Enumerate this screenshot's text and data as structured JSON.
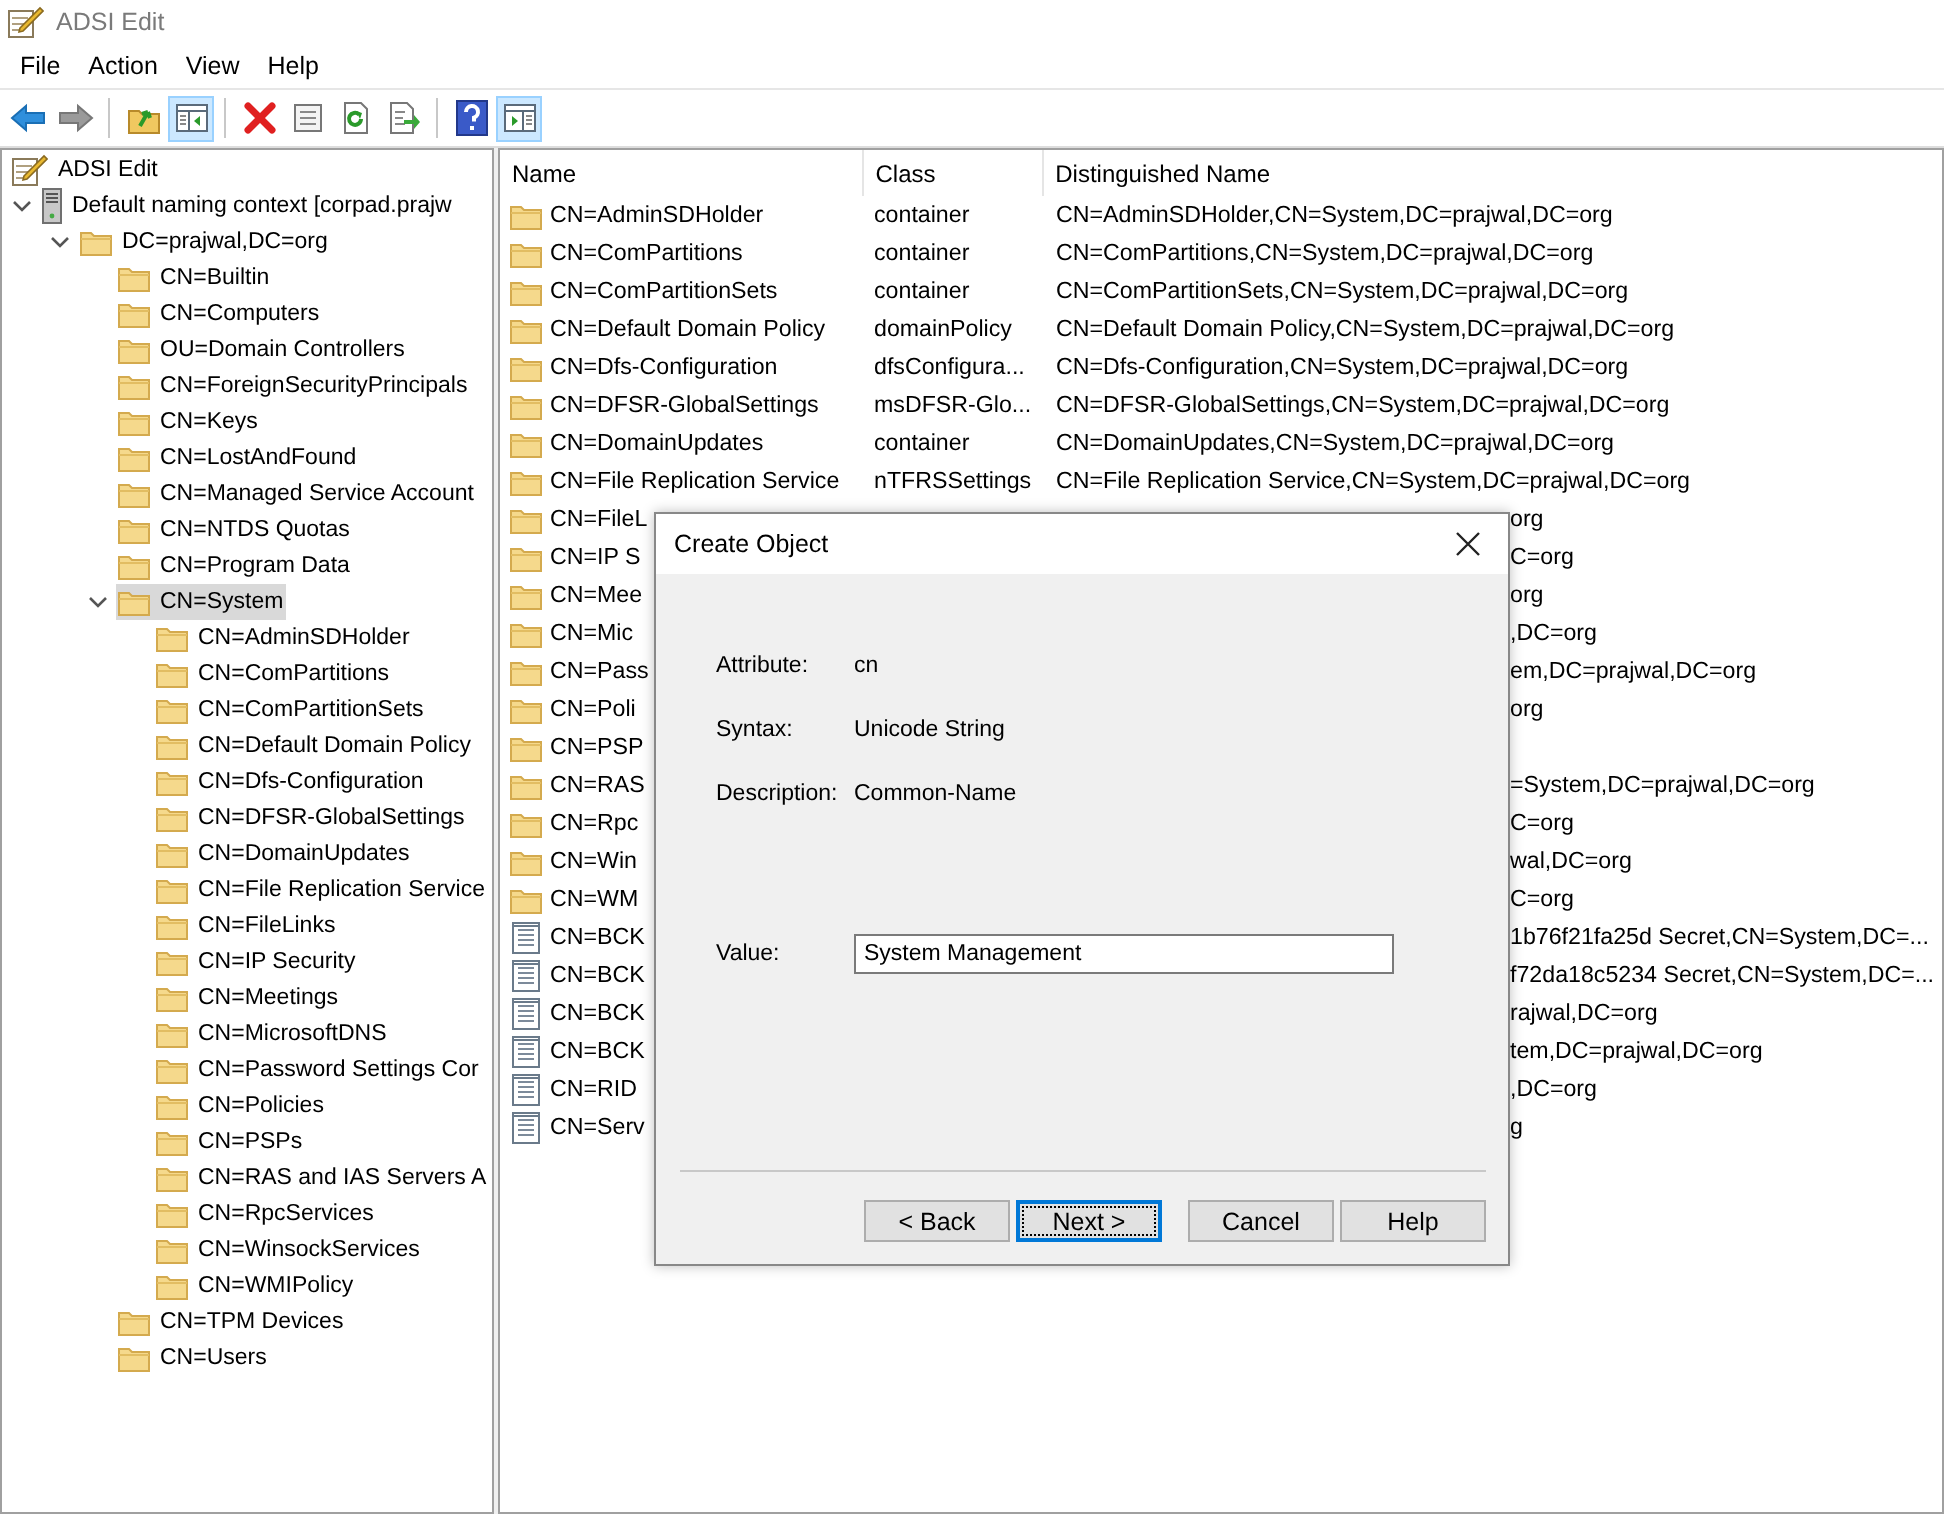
{
  "window": {
    "title": "ADSI Edit"
  },
  "menu": [
    "File",
    "Action",
    "View",
    "Help"
  ],
  "toolbar": [
    {
      "kind": "back",
      "pressed": false
    },
    {
      "kind": "forward",
      "pressed": false
    },
    {
      "kind": "sep"
    },
    {
      "kind": "up",
      "pressed": false
    },
    {
      "kind": "tree",
      "pressed": true
    },
    {
      "kind": "sep"
    },
    {
      "kind": "delete",
      "pressed": false
    },
    {
      "kind": "properties",
      "pressed": false
    },
    {
      "kind": "refresh",
      "pressed": false
    },
    {
      "kind": "export",
      "pressed": false
    },
    {
      "kind": "sep"
    },
    {
      "kind": "help",
      "pressed": false
    },
    {
      "kind": "action",
      "pressed": true
    }
  ],
  "tree": [
    {
      "label": "ADSI Edit",
      "kind": "snapin",
      "selected": false,
      "children": [
        {
          "label": "Default naming context [corpad.prajw",
          "kind": "server",
          "expanded": true,
          "selected": false,
          "children": [
            {
              "label": "DC=prajwal,DC=org",
              "kind": "folder",
              "expanded": true,
              "selected": false,
              "children": [
                {
                  "label": "CN=Builtin",
                  "kind": "folder",
                  "selected": false
                },
                {
                  "label": "CN=Computers",
                  "kind": "folder",
                  "selected": false
                },
                {
                  "label": "OU=Domain Controllers",
                  "kind": "folder",
                  "selected": false
                },
                {
                  "label": "CN=ForeignSecurityPrincipals",
                  "kind": "folder",
                  "selected": false
                },
                {
                  "label": "CN=Keys",
                  "kind": "folder",
                  "selected": false
                },
                {
                  "label": "CN=LostAndFound",
                  "kind": "folder",
                  "selected": false
                },
                {
                  "label": "CN=Managed Service Account",
                  "kind": "folder",
                  "selected": false
                },
                {
                  "label": "CN=NTDS Quotas",
                  "kind": "folder",
                  "selected": false
                },
                {
                  "label": "CN=Program Data",
                  "kind": "folder",
                  "selected": false
                },
                {
                  "label": "CN=System",
                  "kind": "folder",
                  "expanded": true,
                  "selected": true,
                  "children": [
                    {
                      "label": "CN=AdminSDHolder",
                      "kind": "folder",
                      "selected": false
                    },
                    {
                      "label": "CN=ComPartitions",
                      "kind": "folder",
                      "selected": false
                    },
                    {
                      "label": "CN=ComPartitionSets",
                      "kind": "folder",
                      "selected": false
                    },
                    {
                      "label": "CN=Default Domain Policy",
                      "kind": "folder",
                      "selected": false
                    },
                    {
                      "label": "CN=Dfs-Configuration",
                      "kind": "folder",
                      "selected": false
                    },
                    {
                      "label": "CN=DFSR-GlobalSettings",
                      "kind": "folder",
                      "selected": false
                    },
                    {
                      "label": "CN=DomainUpdates",
                      "kind": "folder",
                      "selected": false
                    },
                    {
                      "label": "CN=File Replication Service",
                      "kind": "folder",
                      "selected": false
                    },
                    {
                      "label": "CN=FileLinks",
                      "kind": "folder",
                      "selected": false
                    },
                    {
                      "label": "CN=IP Security",
                      "kind": "folder",
                      "selected": false
                    },
                    {
                      "label": "CN=Meetings",
                      "kind": "folder",
                      "selected": false
                    },
                    {
                      "label": "CN=MicrosoftDNS",
                      "kind": "folder",
                      "selected": false
                    },
                    {
                      "label": "CN=Password Settings Cor",
                      "kind": "folder",
                      "selected": false
                    },
                    {
                      "label": "CN=Policies",
                      "kind": "folder",
                      "selected": false
                    },
                    {
                      "label": "CN=PSPs",
                      "kind": "folder",
                      "selected": false
                    },
                    {
                      "label": "CN=RAS and IAS Servers A",
                      "kind": "folder",
                      "selected": false
                    },
                    {
                      "label": "CN=RpcServices",
                      "kind": "folder",
                      "selected": false
                    },
                    {
                      "label": "CN=WinsockServices",
                      "kind": "folder",
                      "selected": false
                    },
                    {
                      "label": "CN=WMIPolicy",
                      "kind": "folder",
                      "selected": false
                    }
                  ]
                },
                {
                  "label": "CN=TPM Devices",
                  "kind": "folder",
                  "selected": false
                },
                {
                  "label": "CN=Users",
                  "kind": "folder",
                  "selected": false
                }
              ]
            }
          ]
        }
      ]
    }
  ],
  "list": {
    "columns": [
      "Name",
      "Class",
      "Distinguished Name"
    ],
    "rows": [
      {
        "kind": "folder",
        "name": "CN=AdminSDHolder",
        "class": "container",
        "dn": "CN=AdminSDHolder,CN=System,DC=prajwal,DC=org"
      },
      {
        "kind": "folder",
        "name": "CN=ComPartitions",
        "class": "container",
        "dn": "CN=ComPartitions,CN=System,DC=prajwal,DC=org"
      },
      {
        "kind": "folder",
        "name": "CN=ComPartitionSets",
        "class": "container",
        "dn": "CN=ComPartitionSets,CN=System,DC=prajwal,DC=org"
      },
      {
        "kind": "folder",
        "name": "CN=Default Domain Policy",
        "class": "domainPolicy",
        "dn": "CN=Default Domain Policy,CN=System,DC=prajwal,DC=org"
      },
      {
        "kind": "folder",
        "name": "CN=Dfs-Configuration",
        "class": "dfsConfigura...",
        "dn": "CN=Dfs-Configuration,CN=System,DC=prajwal,DC=org"
      },
      {
        "kind": "folder",
        "name": "CN=DFSR-GlobalSettings",
        "class": "msDFSR-Glo...",
        "dn": "CN=DFSR-GlobalSettings,CN=System,DC=prajwal,DC=org"
      },
      {
        "kind": "folder",
        "name": "CN=DomainUpdates",
        "class": "container",
        "dn": "CN=DomainUpdates,CN=System,DC=prajwal,DC=org"
      },
      {
        "kind": "folder",
        "name": "CN=File Replication Service",
        "class": "nTFRSSettings",
        "dn": "CN=File Replication Service,CN=System,DC=prajwal,DC=org"
      },
      {
        "kind": "folder",
        "name": "CN=FileL",
        "dn": "org"
      },
      {
        "kind": "folder",
        "name": "CN=IP S",
        "dn": "C=org"
      },
      {
        "kind": "folder",
        "name": "CN=Mee",
        "dn": "org"
      },
      {
        "kind": "folder",
        "name": "CN=Mic",
        "dn": ",DC=org"
      },
      {
        "kind": "folder",
        "name": "CN=Pass",
        "dn": "em,DC=prajwal,DC=org"
      },
      {
        "kind": "folder",
        "name": "CN=Poli",
        "dn": "org"
      },
      {
        "kind": "folder",
        "name": "CN=PSP"
      },
      {
        "kind": "folder",
        "name": "CN=RAS",
        "dn": "=System,DC=prajwal,DC=org"
      },
      {
        "kind": "folder",
        "name": "CN=Rpc",
        "dn": "C=org"
      },
      {
        "kind": "folder",
        "name": "CN=Win",
        "dn": "wal,DC=org"
      },
      {
        "kind": "folder",
        "name": "CN=WM",
        "dn": "C=org"
      },
      {
        "kind": "entry",
        "name": "CN=BCK",
        "dn": "1b76f21fa25d Secret,CN=System,DC=..."
      },
      {
        "kind": "entry",
        "name": "CN=BCK",
        "dn": "f72da18c5234 Secret,CN=System,DC=..."
      },
      {
        "kind": "entry",
        "name": "CN=BCK",
        "dn": "rajwal,DC=org"
      },
      {
        "kind": "entry",
        "name": "CN=BCK",
        "dn": "tem,DC=prajwal,DC=org"
      },
      {
        "kind": "entry",
        "name": "CN=RID",
        "dn": ",DC=org"
      },
      {
        "kind": "entry",
        "name": "CN=Serv",
        "dn": "g"
      }
    ]
  },
  "dialog": {
    "title": "Create Object",
    "fields": [
      {
        "label": "Attribute:",
        "value": "cn"
      },
      {
        "label": "Syntax:",
        "value": "Unicode String"
      },
      {
        "label": "Description:",
        "value": "Common-Name"
      }
    ],
    "input": {
      "label": "Value:",
      "value": "System Management"
    },
    "buttons": [
      {
        "label": "< Back",
        "default": false
      },
      {
        "label": "Next >",
        "default": true
      },
      {
        "label": "Cancel",
        "default": false
      },
      {
        "label": "Help",
        "default": false
      }
    ]
  }
}
